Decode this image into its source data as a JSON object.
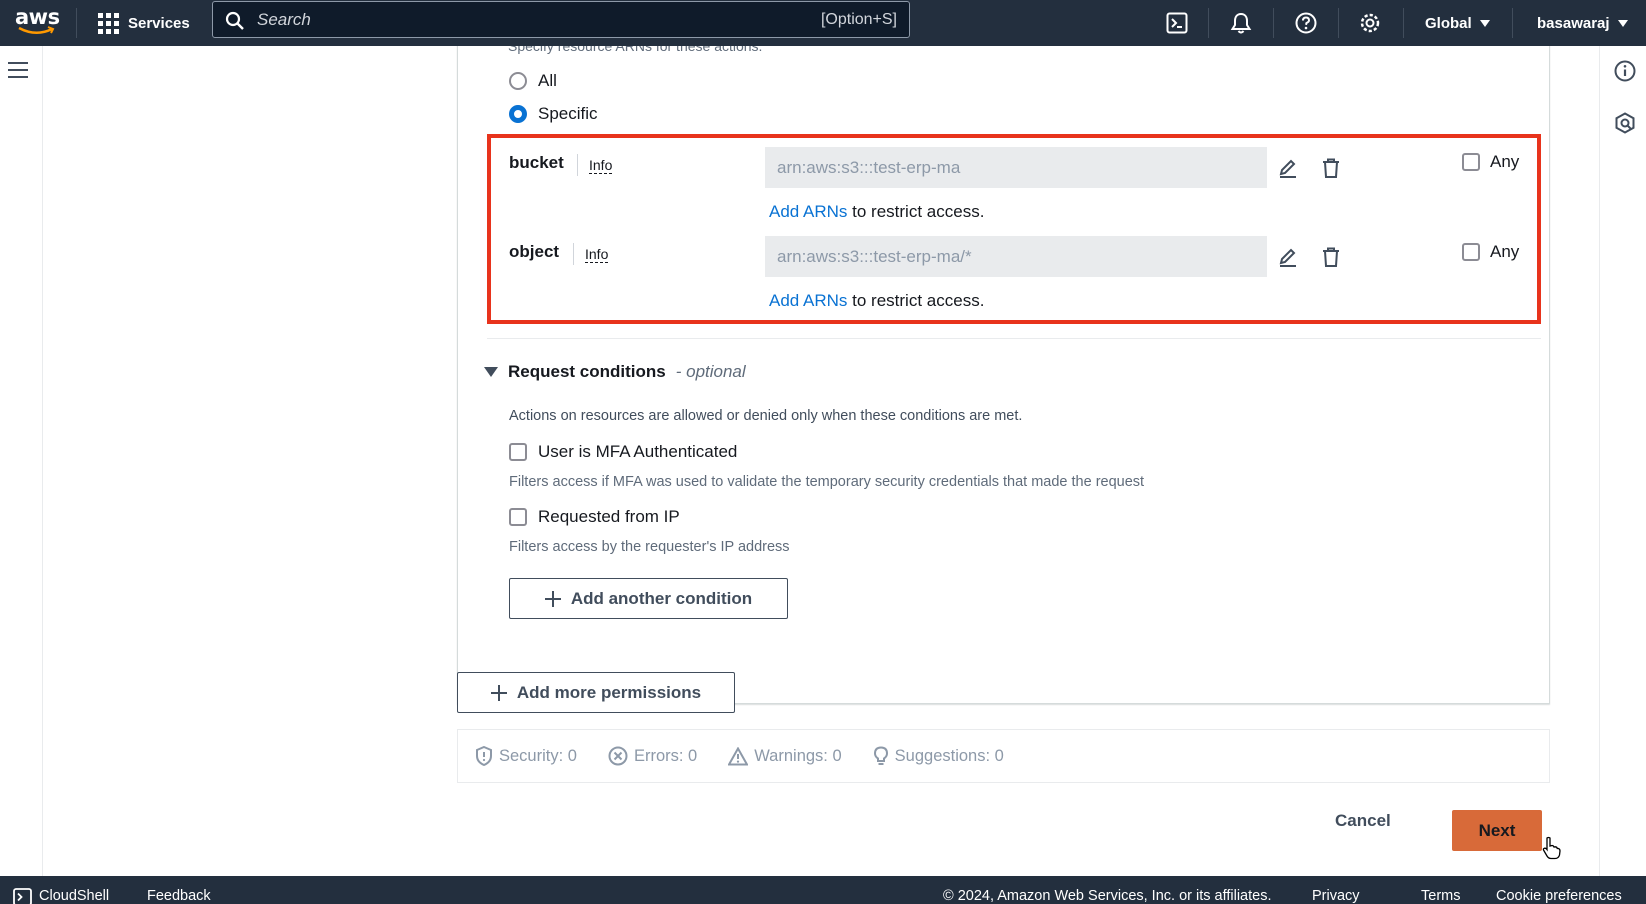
{
  "topnav": {
    "logo": "aws",
    "services_label": "Services",
    "search_placeholder": "Search",
    "search_shortcut": "[Option+S]",
    "region_label": "Global",
    "account_label": "basawaraj",
    "icons": [
      "cloudshell-icon",
      "bell-icon",
      "help-icon",
      "settings-icon"
    ]
  },
  "resources": {
    "clipped_description": "Specify resource ARNs for these actions.",
    "options": [
      {
        "label": "All",
        "selected": false
      },
      {
        "label": "Specific",
        "selected": true
      }
    ],
    "items": [
      {
        "label": "bucket",
        "info": "Info",
        "arn": "arn:aws:s3:::test-erp-ma",
        "add_arns_link": "Add ARNs",
        "add_arns_suffix": " to restrict access.",
        "any_label": "Any",
        "any_checked": false
      },
      {
        "label": "object",
        "info": "Info",
        "arn": "arn:aws:s3:::test-erp-ma/*",
        "add_arns_link": "Add ARNs",
        "add_arns_suffix": " to restrict access.",
        "any_label": "Any",
        "any_checked": false
      }
    ]
  },
  "conditions": {
    "title": "Request conditions",
    "optional": "- optional",
    "description": "Actions on resources are allowed or denied only when these conditions are met.",
    "items": [
      {
        "label": "User is MFA Authenticated",
        "checked": false,
        "description": "Filters access if MFA was used to validate the temporary security credentials that made the request"
      },
      {
        "label": "Requested from IP",
        "checked": false,
        "description": "Filters access by the requester's IP address"
      }
    ],
    "add_condition_label": "Add another condition"
  },
  "add_permissions_label": "Add more permissions",
  "validation": {
    "security": "Security: 0",
    "errors": "Errors: 0",
    "warnings": "Warnings: 0",
    "suggestions": "Suggestions: 0"
  },
  "actions": {
    "cancel": "Cancel",
    "next": "Next"
  },
  "footer": {
    "cloudshell": "CloudShell",
    "feedback": "Feedback",
    "copyright": "© 2024, Amazon Web Services, Inc. or its affiliates.",
    "privacy": "Privacy",
    "terms": "Terms",
    "cookie": "Cookie preferences"
  },
  "colors": {
    "nav_bg": "#232f3e",
    "link": "#0972d3",
    "highlight_border": "#e8331c",
    "primary_button": "#d86a39"
  }
}
